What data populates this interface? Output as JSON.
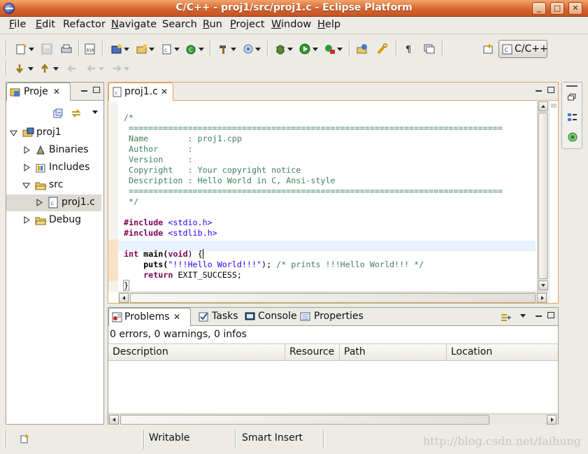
{
  "window": {
    "title": "C/C++ - proj1/src/proj1.c - Eclipse Platform",
    "minimize": "_",
    "maximize": "□",
    "close": "✕"
  },
  "menu": [
    {
      "label": "File",
      "u": "F",
      "rest": "ile"
    },
    {
      "label": "Edit",
      "u": "E",
      "rest": "dit"
    },
    {
      "label": "Refactor",
      "u": "",
      "rest": "Refactor"
    },
    {
      "label": "Navigate",
      "u": "N",
      "rest": "avigate"
    },
    {
      "label": "Search",
      "u": "",
      "rest": "Search"
    },
    {
      "label": "Run",
      "u": "R",
      "rest": "un"
    },
    {
      "label": "Project",
      "u": "P",
      "rest": "roject"
    },
    {
      "label": "Window",
      "u": "W",
      "rest": "indow"
    },
    {
      "label": "Help",
      "u": "H",
      "rest": "elp"
    }
  ],
  "perspective": {
    "label": "C/C++"
  },
  "project_explorer": {
    "tab_label": "Proje",
    "tree": [
      {
        "label": "proj1",
        "icon": "project-icon",
        "expanded": true
      },
      {
        "label": "Binaries",
        "icon": "binaries-icon"
      },
      {
        "label": "Includes",
        "icon": "includes-icon"
      },
      {
        "label": "src",
        "icon": "folder-icon",
        "expanded": true
      },
      {
        "label": "proj1.c",
        "icon": "c-file-icon",
        "selected": true
      },
      {
        "label": "Debug",
        "icon": "folder-icon"
      }
    ]
  },
  "editor": {
    "tab_label": "proj1.c",
    "lines": {
      "l1": "/*",
      "l2": " ============================================================================",
      "l3": " Name        : proj1.cpp",
      "l4": " Author      :",
      "l5": " Version     :",
      "l6": " Copyright   : Your copyright notice",
      "l7": " Description : Hello World in C, Ansi-style",
      "l8": " ============================================================================",
      "l9": " */",
      "inc1_kw": "#include",
      "inc1_file": " <stdio.h>",
      "inc2_kw": "#include",
      "inc2_file": " <stdlib.h>",
      "main_kw1": "int",
      "main_name": " main(",
      "main_kw2": "void",
      "main_rest": ") {",
      "puts_name": "    puts(",
      "puts_str": "\"!!!Hello World!!!\"",
      "puts_rest": ");",
      "puts_comment": " /* prints !!!Hello World!!! */",
      "ret_kw": "    return",
      "ret_rest": " EXIT_SUCCESS;",
      "close_brace": "}"
    }
  },
  "bottom_panel": {
    "tabs": [
      "Problems",
      "Tasks",
      "Console",
      "Properties"
    ],
    "summary": "0 errors, 0 warnings, 0 infos",
    "columns": [
      "Description",
      "Resource",
      "Path",
      "Location"
    ]
  },
  "status": {
    "writable": "Writable",
    "insert_mode": "Smart Insert"
  },
  "watermark": "http://blog.csdn.net/faihung"
}
